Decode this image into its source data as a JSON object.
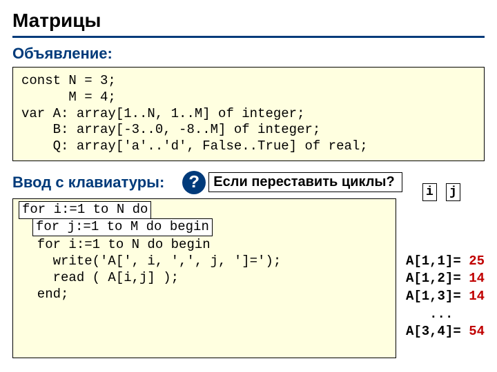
{
  "title": "Матрицы",
  "section_declare": "Объявление:",
  "decl_code": "const N = 3;\n      M = 4;\nvar A: array[1..N, 1..M] of integer;\n    B: array[-3..0, -8..M] of integer;\n    Q: array['a'..'d', False..True] of real;",
  "section_input": "Ввод с клавиатуры:",
  "question": "Если переставить циклы?",
  "qmark": "?",
  "input_code": "for j:=1 to M do\n  for i:=1 to N do begin\n    write('A[', i, ',', j, ']=');\n    read ( A[i,j] );\n  end;",
  "hilite1": "for i:=1 to N do",
  "hilite2": "for j:=1 to M do begin",
  "i_label": "i",
  "j_label": "j",
  "out1_lhs": "A[1,1]=",
  "out1_val": "25",
  "out2_lhs": "A[1,2]=",
  "out2_val": "14",
  "out3_lhs": "A[1,3]=",
  "out3_val": "14",
  "out_dots": "   ...",
  "out5_lhs": "A[3,4]=",
  "out5_val": "54"
}
